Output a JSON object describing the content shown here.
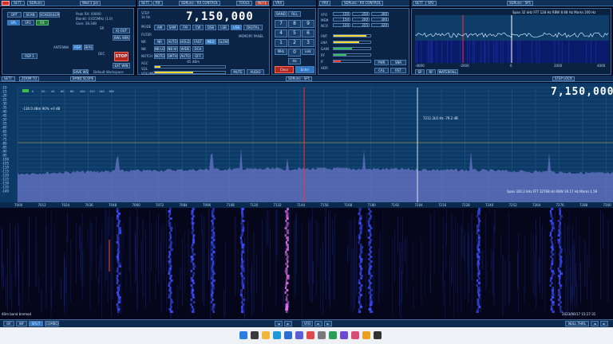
{
  "topbar": {
    "left_title": "SDRuno",
    "main_title": "SDRuno - MAIN",
    "rx_title": "SDRuno - RX CONTROL",
    "spectrum_title": "SDRuno - SP1",
    "mid_title": "SDRuno - RX CONTROL",
    "time_hint": "Wed 2 Jun",
    "settings_label": "SETT.",
    "rx_label": "RX",
    "tools_label": "TOOLS",
    "vrx_label": "VRX",
    "note_label": "NOTE"
  },
  "main_panel": {
    "buttons": [
      "OPT",
      "SCAN",
      "SCHEDULER"
    ],
    "sub_buttons": [
      "SPL",
      "SP2",
      "RX"
    ],
    "status_lines": [
      "Peak RX: 00000",
      "Blankt: 0.655MHz (1.0)",
      "Gain: 28.3dB"
    ],
    "rsp_label": "RSP",
    "antenna_label": "ANTENNA",
    "bias_label": "BIAS",
    "lna_label": "LNA",
    "stop_label": "STOP",
    "start_label": "START",
    "rsp_select": "RSP 1",
    "workspace_label": "Default Workspace",
    "save_label": "SAVE WS",
    "sample_label": "SR",
    "dec_label": "DEC",
    "side_btn_labels": [
      "IQ OUT",
      "BWL WIN",
      "REC",
      "EXT WIN"
    ]
  },
  "rx_panel": {
    "frequency": "7,150,000",
    "mode_label": "MODE",
    "mode_buttons": [
      "AM",
      "SAM",
      "FM",
      "CW",
      "DSB",
      "LSB",
      "USB",
      "DIGITAL"
    ],
    "filter_label": "FILTER",
    "step_label": "STEP",
    "step_value": "1k Hz",
    "row_labels": [
      "NR",
      "NB",
      "NOTCH",
      "AGC",
      "SQL",
      "VOLUME"
    ],
    "row_buttons": [
      [
        "NR",
        "AUTO",
        "HOLD",
        "FAST",
        "MED",
        "SLOW"
      ],
      [
        "NB LO",
        "NB HI",
        "WIDE",
        "DCH"
      ],
      [
        "NOTCH",
        "SMTH",
        "AUTO",
        "OFF"
      ]
    ],
    "mem_label": "MEMORY PANEL",
    "signal": "-65 dBm",
    "squelch": "SQL",
    "volume_level": 0.55,
    "mute_label": "MUTE",
    "audio_label": "AUDIO"
  },
  "keypad": {
    "keys": [
      "7",
      "8",
      "9",
      "4",
      "5",
      "6",
      "1",
      "2",
      "3",
      "0",
      "Clear",
      "Enter"
    ],
    "units": [
      "MHz",
      "kHz",
      "Hz"
    ],
    "extra": [
      "BAND",
      "RCL"
    ]
  },
  "rx_control": {
    "rows": [
      {
        "label": "VFO",
        "value1": "150",
        "value2": "250",
        "value3": "300"
      },
      {
        "label": "MEM",
        "value1": "150",
        "value2": "200",
        "value3": "300"
      },
      {
        "label": "NCO",
        "value1": "150",
        "value2": "255",
        "value3": "320"
      }
    ],
    "labels": [
      "ANT",
      "LNA",
      "GAIN",
      "RF",
      "IF",
      "HDR"
    ],
    "bar_levels": [
      0.9,
      0.7,
      0.5,
      0.35,
      0.2
    ],
    "bar_colors": [
      "#ffd530",
      "#ffd530",
      "#3dbb56",
      "#3dbb56",
      "#ff3b30"
    ],
    "footer_buttons": [
      "PWR",
      "SNR",
      "CAL",
      "RST"
    ]
  },
  "sp2": {
    "title": "SP2",
    "readout": "Span 32 kHz  FFT 128 Hz  RBW 8.68 Hz  Marks 200 Hz",
    "ticks": [
      "-4000",
      "-2000",
      "0",
      "2000",
      "4000"
    ],
    "labels": [
      "SP",
      "RF",
      "WATERFALL"
    ]
  },
  "spectrum": {
    "toolbar": [
      "SETT.",
      "ZOOM TO",
      "BAND SCOPE"
    ],
    "step_lock_label": "STEP LOCK",
    "frequency": "7,150,000",
    "overlay": "-130.0 dBm  90%  +0 dB",
    "marker_text": "7211.2LO  Hz  -79.2 dB",
    "readout": "Span 320.2 kHz  FFT 32768 Hz  RBW 19.17 Hz  Marks 1.59",
    "y_ticks": [
      "-10",
      "-15",
      "-20",
      "-25",
      "-30",
      "-35",
      "-40",
      "-45",
      "-50",
      "-55",
      "-60",
      "-65",
      "-70",
      "-75",
      "-80",
      "-85",
      "-90",
      "-95",
      "-100",
      "-105",
      "-110",
      "-115",
      "-120",
      "-125",
      "-130",
      "-135",
      "-140"
    ],
    "x_ticks": [
      "7000",
      "7012",
      "7024",
      "7036",
      "7048",
      "7060",
      "7072",
      "7084",
      "7096",
      "7108",
      "7120",
      "7132",
      "7144",
      "7156",
      "7168",
      "7180",
      "7192",
      "7204",
      "7216",
      "7228",
      "7240",
      "7252",
      "7264",
      "7276",
      "7288",
      "7300"
    ],
    "legend_ticks": [
      "0",
      "20",
      "40",
      "60",
      "80",
      "100",
      "120",
      "140",
      "160"
    ],
    "wf_status": "40m band bremod",
    "date": "2023/06/17 15:27:31",
    "bottom_buttons": [
      "OF",
      "WF",
      "SPLIT",
      "COMBO"
    ],
    "center_buttons": [
      "◄",
      "►",
      "VFO",
      "►",
      "►"
    ],
    "right_buttons": [
      "NULL THRL",
      "◄",
      "►"
    ]
  },
  "taskbar": {
    "icons": [
      "start",
      "search",
      "files",
      "edge",
      "mail",
      "store",
      "photos",
      "settings",
      "calendar",
      "chat",
      "media",
      "chrome",
      "terminal"
    ]
  }
}
